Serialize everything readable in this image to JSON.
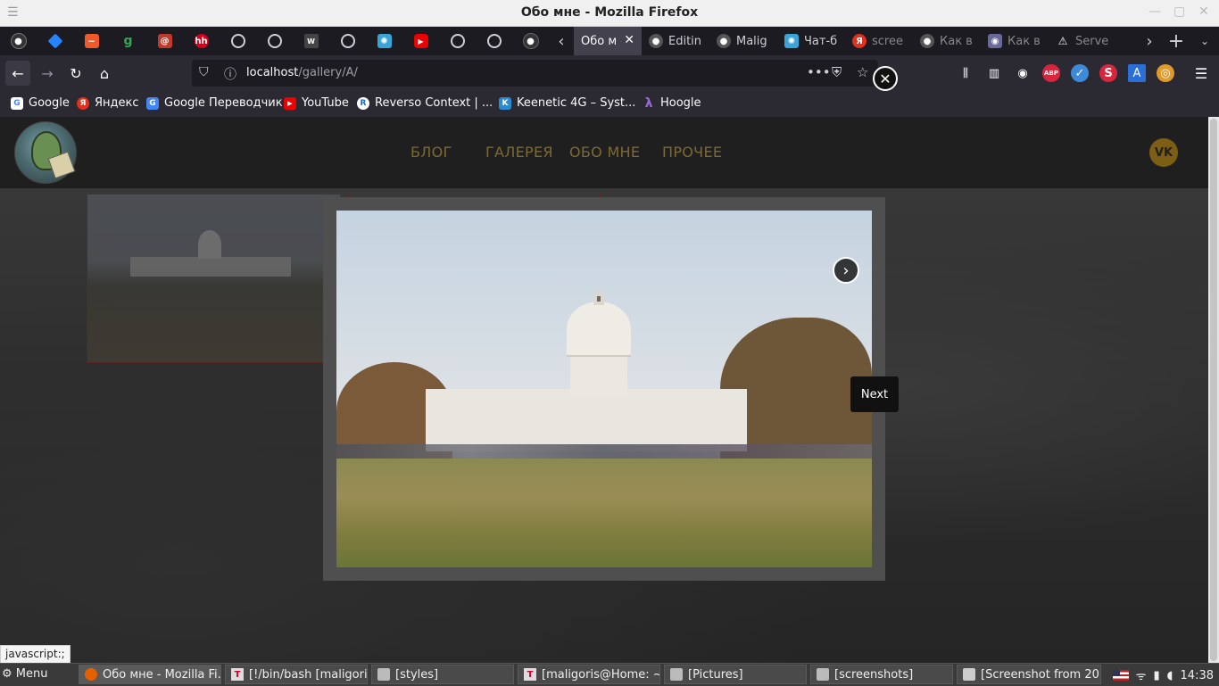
{
  "window": {
    "title": "Обо мне - Mozilla Firefox"
  },
  "tabs": {
    "pinned_icons": [
      "github-icon",
      "jira-icon",
      "grafana-icon",
      "google-icon",
      "app-icon",
      "hh-icon",
      "globe-icon",
      "globe-icon",
      "wix-icon",
      "globe-icon",
      "app-icon",
      "youtube-icon",
      "globe-icon",
      "globe-icon",
      "github-icon"
    ],
    "items": [
      {
        "label": "Обо м",
        "active": true
      },
      {
        "label": "Editin"
      },
      {
        "label": "Malig"
      },
      {
        "label": "Чат-б"
      },
      {
        "label": "scree"
      },
      {
        "label": "Как в"
      },
      {
        "label": "Как в"
      },
      {
        "label": "Serve"
      }
    ]
  },
  "navbar": {
    "url_host": "localhost",
    "url_path": "/gallery/A/"
  },
  "bookmarks": [
    {
      "label": "Google",
      "icon": "G",
      "color": "#4285f4"
    },
    {
      "label": "Яндекс",
      "icon": "Я",
      "color": "#e0301e"
    },
    {
      "label": "Google Переводчик",
      "icon": "G",
      "color": "#4285f4"
    },
    {
      "label": "YouTube",
      "icon": "▶",
      "color": "#e00"
    },
    {
      "label": "Reverso Context | ...",
      "icon": "R",
      "color": "#1b6ac9"
    },
    {
      "label": "Keenetic 4G – Syst...",
      "icon": "K",
      "color": "#2a8bd1"
    },
    {
      "label": "Hoogle",
      "icon": "λ",
      "color": "#5b3ea6"
    }
  ],
  "site": {
    "menu": [
      "БЛОГ",
      "ГАЛЕРЕЯ",
      "ОБО МНЕ",
      "ПРОЧЕЕ"
    ],
    "vk_label": "VK"
  },
  "lightbox": {
    "tooltip": "Next"
  },
  "status_link": "javascript:;",
  "taskbar": {
    "menu_label": "Menu",
    "tasks": [
      {
        "label": "Обо мне - Mozilla Fi...",
        "icon": "firefox"
      },
      {
        "label": "[!/bin/bash [maligori...",
        "icon": "terminal"
      },
      {
        "label": "[styles]",
        "icon": "folder"
      },
      {
        "label": "[maligoris@Home: ~...",
        "icon": "terminal"
      },
      {
        "label": "[Pictures]",
        "icon": "folder"
      },
      {
        "label": "[screenshots]",
        "icon": "folder"
      },
      {
        "label": "[Screenshot from 20...",
        "icon": "image"
      }
    ],
    "clock": "14:38"
  }
}
